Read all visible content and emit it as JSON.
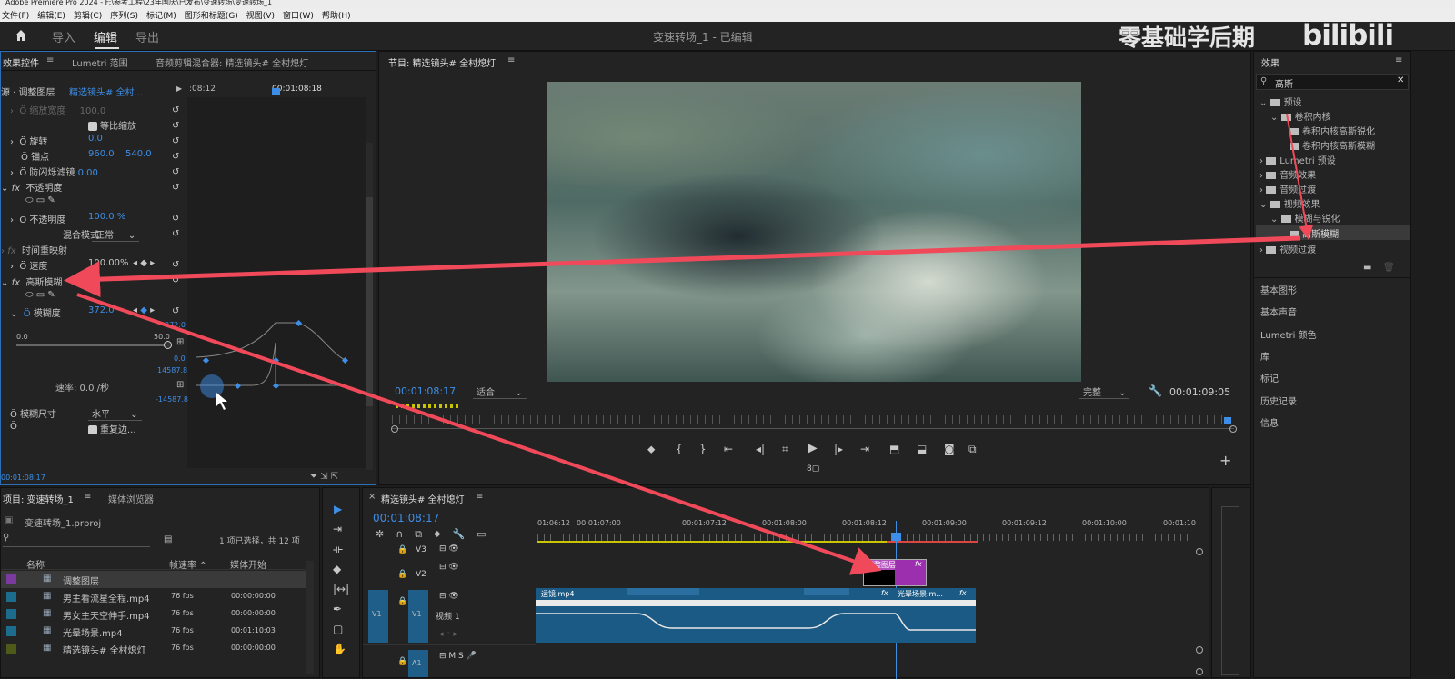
{
  "titlebar": {
    "text": "Adobe Premiere Pro 2024 - F:\\参考工程\\23年国庆\\已发布\\变速转场\\变速转场_1"
  },
  "menu": [
    "文件(F)",
    "编辑(E)",
    "剪辑(C)",
    "序列(S)",
    "标记(M)",
    "图形和标题(G)",
    "视图(V)",
    "窗口(W)",
    "帮助(H)"
  ],
  "workspace": {
    "tabs": [
      "导入",
      "编辑",
      "导出"
    ],
    "project_title": "变速转场_1 - 已编辑",
    "watermark": "零基础学后期",
    "watermark_logo": "bilibili"
  },
  "effect_controls": {
    "tabs": [
      "效果控件",
      "Lumetri 范围",
      "音频剪辑混合器: 精选镜头# 全村熄灯"
    ],
    "source": "源 · 调整图层",
    "clip": "精选镜头# 全村...",
    "t_left": ":08:12",
    "t_playhead": "00:01:08:18",
    "rows": {
      "scale_w": "缩放宽度",
      "scale_w_val": "100.0",
      "uniform": "等比缩放",
      "rotation": "旋转",
      "rotation_val": "0.0",
      "anchor": "锚点",
      "anchor_x": "960.0",
      "anchor_y": "540.0",
      "flicker": "防闪烁滤镜",
      "flicker_val": "0.00",
      "opacity_hdr": "不透明度",
      "opacity": "不透明度",
      "opacity_val": "100.0 %",
      "blend": "混合模式",
      "blend_val": "正常",
      "timeremap": "时间重映射",
      "speed": "速度",
      "speed_val": "100.00%",
      "gauss": "高斯模糊",
      "blur": "模糊度",
      "blur_val": "372.0",
      "g_top": "372.0",
      "g_zero": "0.0",
      "g_range_l": "0.0",
      "g_range_r": "50.0",
      "v_top": "14587.8",
      "v_bot": "-14587.8",
      "rate": "速率: 0.0 /秒",
      "dim": "模糊尺寸",
      "dim_val": "水平",
      "repeat": "重复边..."
    },
    "timecode": "00:01:08:17"
  },
  "program": {
    "title": "节目: 精选镜头# 全村熄灯",
    "timecode": "00:01:08:17",
    "fit": "适合",
    "quality": "完整",
    "duration": "00:01:09:05"
  },
  "effects": {
    "title": "效果",
    "search": "高斯",
    "tree": [
      "预设",
      "卷积内核",
      "卷积内核高斯锐化",
      "卷积内核高斯模糊",
      "Lumetri 预设",
      "音频效果",
      "音频过渡",
      "视频效果",
      "模糊与锐化",
      "高斯模糊",
      "视频过渡"
    ],
    "sections": [
      "基本图形",
      "基本声音",
      "Lumetri 颜色",
      "库",
      "标记",
      "历史记录",
      "信息"
    ]
  },
  "project": {
    "tabs": [
      "项目: 变速转场_1",
      "媒体浏览器"
    ],
    "file": "变速转场_1.prproj",
    "count": "1 项已选择，共 12 项",
    "cols": [
      "名称",
      "帧速率",
      "媒体开始"
    ],
    "items": [
      {
        "name": "调整图层",
        "fps": "",
        "start": "",
        "color": "#7b3aa0"
      },
      {
        "name": "男主看流星全程.mp4",
        "fps": "76 fps",
        "start": "00:00:00:00",
        "color": "#1c6c8e"
      },
      {
        "name": "男女主天空伸手.mp4",
        "fps": "76 fps",
        "start": "00:00:00:00",
        "color": "#1c6c8e"
      },
      {
        "name": "光晕场景.mp4",
        "fps": "76 fps",
        "start": "00:01:10:03",
        "color": "#1c6c8e"
      },
      {
        "name": "精选镜头# 全村熄灯",
        "fps": "76 fps",
        "start": "00:00:00:00",
        "color": "#4d5a1a"
      }
    ]
  },
  "timeline": {
    "title": "精选镜头# 全村熄灯",
    "timecode": "00:01:08:17",
    "ruler": [
      "01:06:12",
      "00:01:07:00",
      "00:01:07:12",
      "00:01:08:00",
      "00:01:08:12",
      "00:01:09:00",
      "00:01:09:12",
      "00:01:10:00",
      "00:01:10"
    ],
    "tracks": [
      "V3",
      "V2",
      "V1",
      "A1"
    ],
    "v1_name": "视频 1",
    "clip_adj": "调整图层",
    "clip_a": "运镜.mp4",
    "clip_b": "光晕场景.m..."
  }
}
